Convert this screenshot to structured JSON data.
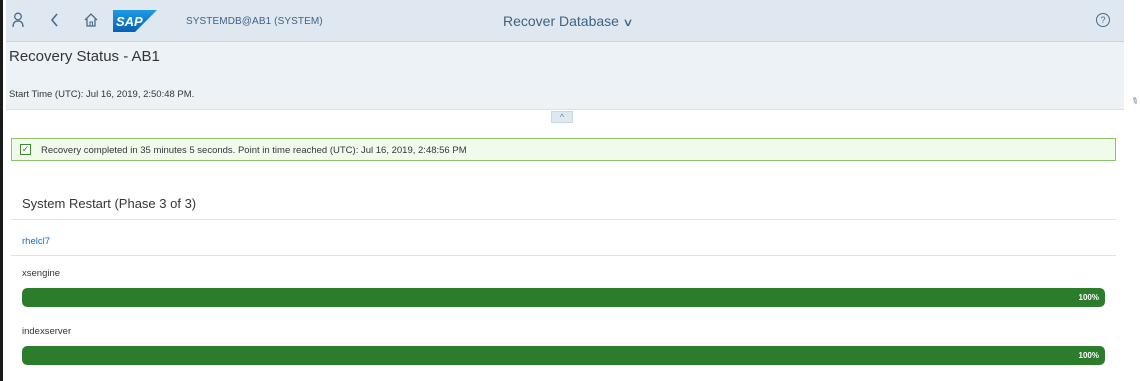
{
  "shell": {
    "system": "SYSTEMDB@AB1 (SYSTEM)",
    "app_title": "Recover Database",
    "logo_text": "SAP",
    "icons": {
      "user": "user-icon",
      "back": "back-arrow-icon",
      "home": "home-icon",
      "help": "help-icon",
      "dropdown": "chevron-down-icon"
    }
  },
  "header": {
    "title": "Recovery Status - AB1",
    "start_time": "Start Time (UTC): Jul 16, 2019, 2:50:48 PM."
  },
  "message": {
    "text": "Recovery completed in 35 minutes 5 seconds. Point in time reached (UTC): Jul 16, 2019, 2:48:56 PM",
    "type": "success"
  },
  "section": {
    "title": "System Restart (Phase 3 of 3)",
    "host": "rhelcl7",
    "services": [
      {
        "name": "xsengine",
        "progress": 100,
        "label": "100%"
      },
      {
        "name": "indexserver",
        "progress": 100,
        "label": "100%"
      }
    ]
  },
  "colors": {
    "shell_bg": "#dfe8f1",
    "success_border": "#8ec36d",
    "progress_fill": "#2b7d2b",
    "link": "#0a6ed1"
  }
}
